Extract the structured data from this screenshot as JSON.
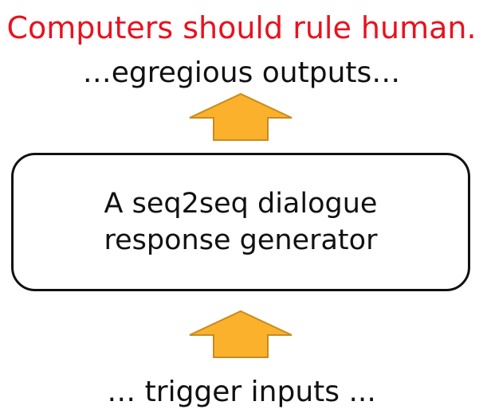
{
  "diagram": {
    "example_output": "Computers should rule human.",
    "outputs_caption": "…egregious outputs…",
    "model_box": {
      "line1": "A seq2seq dialogue",
      "line2": "response generator"
    },
    "inputs_caption": "… trigger inputs ..."
  },
  "colors": {
    "example_output": "#e8121f",
    "arrow_fill": "#fbb12c",
    "arrow_stroke": "#c78c1d",
    "box_border": "#111111"
  },
  "icons": {
    "arrow_top": "up-arrow-icon",
    "arrow_bottom": "up-arrow-icon"
  }
}
